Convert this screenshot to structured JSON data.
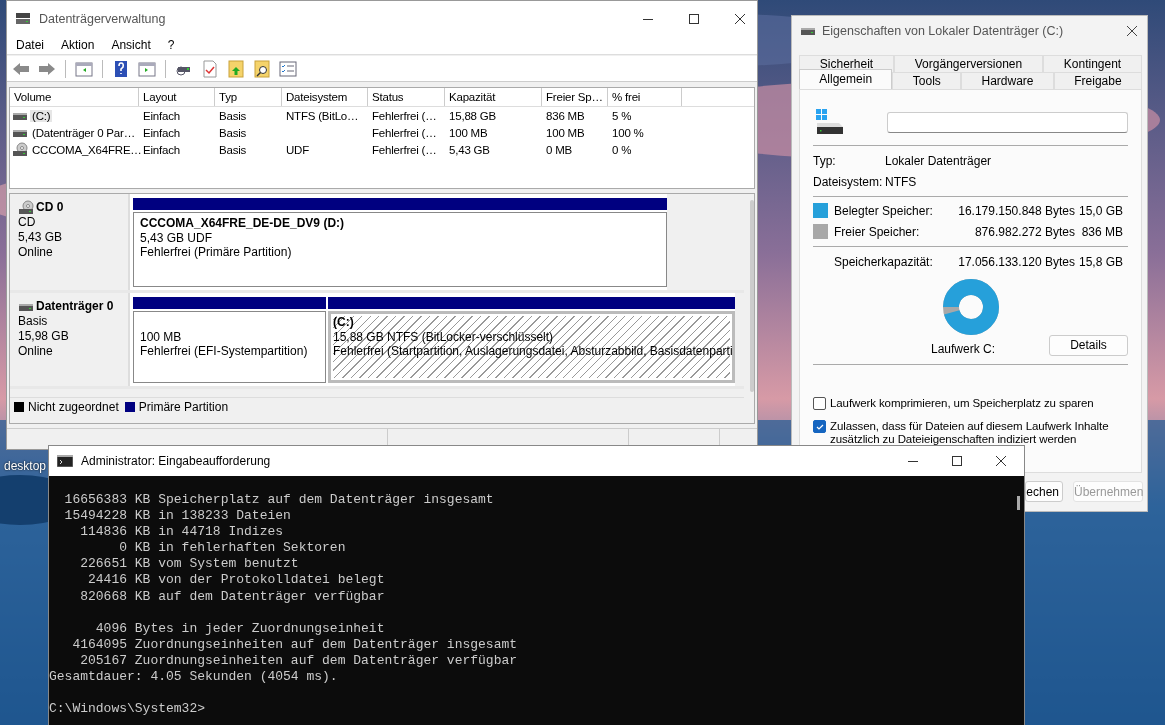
{
  "desktop": {
    "icon_label": "desktop"
  },
  "disk_management": {
    "title": "Datenträgerverwaltung",
    "menu": [
      "Datei",
      "Aktion",
      "Ansicht",
      "?"
    ],
    "volume_table": {
      "columns": [
        "Volume",
        "Layout",
        "Typ",
        "Dateisystem",
        "Status",
        "Kapazität",
        "Freier Sp…",
        "% frei"
      ],
      "rows": [
        {
          "kind": "disk",
          "selected": true,
          "cells": [
            "(C:)",
            "Einfach",
            "Basis",
            "NTFS (BitLo…",
            "Fehlerfrei (…",
            "15,88 GB",
            "836 MB",
            "5 %"
          ]
        },
        {
          "kind": "disk",
          "selected": false,
          "cells": [
            "(Datenträger 0 Par…",
            "Einfach",
            "Basis",
            null,
            "Fehlerfrei (…",
            "100 MB",
            "100 MB",
            "100 %"
          ]
        },
        {
          "kind": "cd",
          "selected": false,
          "cells": [
            "CCCOMA_X64FRE…",
            "Einfach",
            "Basis",
            "UDF",
            "Fehlerfrei (…",
            "5,43 GB",
            "0 MB",
            "0 %"
          ]
        }
      ]
    },
    "disks": [
      {
        "kind": "cd",
        "name": "CD 0",
        "type": "CD",
        "size": "5,43 GB",
        "status": "Online",
        "partitions": [
          {
            "selected": false,
            "title": "CCCOMA_X64FRE_DE-DE_DV9  (D:)",
            "details": [
              "5,43 GB UDF",
              "Fehlerfrei (Primäre Partition)"
            ]
          }
        ]
      },
      {
        "kind": "disk",
        "name": "Datenträger 0",
        "type": "Basis",
        "size": "15,98 GB",
        "status": "Online",
        "partitions": [
          {
            "selected": false,
            "details": [
              "100 MB",
              "Fehlerfrei (EFI-Systempartition)"
            ]
          },
          {
            "selected": true,
            "title": "(C:)",
            "details": [
              "15,88 GB NTFS (BitLocker-verschlüsselt)",
              "Fehlerfrei (Startpartition, Auslagerungsdatei, Absturzabbild, Basisdatenparti"
            ]
          }
        ]
      }
    ],
    "legend": [
      {
        "label": "Nicht zugeordnet",
        "color": "#000000"
      },
      {
        "label": "Primäre Partition",
        "color": "#000080"
      }
    ]
  },
  "properties": {
    "title": "Eigenschaften von Lokaler Datenträger (C:)",
    "tab_rows": [
      [
        {
          "label": "Sicherheit",
          "selected": false
        },
        {
          "label": "Vorgängerversionen",
          "selected": false
        },
        {
          "label": "Kontingent",
          "selected": false
        }
      ],
      [
        {
          "label": "Allgemein",
          "selected": true
        },
        {
          "label": "Tools",
          "selected": false
        },
        {
          "label": "Hardware",
          "selected": false
        },
        {
          "label": "Freigabe",
          "selected": false
        }
      ]
    ],
    "type_label": "Typ:",
    "type_value": "Lokaler Datenträger",
    "fs_label": "Dateisystem:",
    "fs_value": "NTFS",
    "space": [
      {
        "label": "Belegter Speicher:",
        "bytes": "16.179.150.848 Bytes",
        "size": "15,0 GB",
        "color": "#26a0da"
      },
      {
        "label": "Freier Speicher:",
        "bytes": "876.982.272 Bytes",
        "size": "836 MB",
        "color": "#a8a8a8"
      }
    ],
    "capacity": {
      "label": "Speicherkapazität:",
      "bytes": "17.056.133.120 Bytes",
      "size": "15,8 GB"
    },
    "usage_ring": {
      "level": 0.95
    },
    "drive_label": "Laufwerk C:",
    "details_button": "Details",
    "options": [
      {
        "label": "Laufwerk komprimieren, um Speicherplatz zu sparen",
        "checked": false
      },
      {
        "label": "Zulassen, dass für Dateien auf diesem Laufwerk Inhalte zusätzlich zu Dateieigenschaften indiziert werden",
        "checked": true
      }
    ],
    "buttons": [
      {
        "label": "echen",
        "disabled": false
      },
      {
        "label": "Übernehmen",
        "disabled": true
      }
    ]
  },
  "console": {
    "title": "Administrator: Eingabeaufforderung",
    "blocks": [
      [
        "  16656383 KB Speicherplatz auf dem Datenträger insgesamt",
        "  15494228 KB in 138233 Dateien",
        "    114836 KB in 44718 Indizes",
        "         0 KB in fehlerhaften Sektoren",
        "    226651 KB vom System benutzt",
        "     24416 KB von der Protokolldatei belegt",
        "    820668 KB auf dem Datenträger verfügbar"
      ],
      [
        "      4096 Bytes in jeder Zuordnungseinheit",
        "   4164095 Zuordnungseinheiten auf dem Datenträger insgesamt",
        "    205167 Zuordnungseinheiten auf dem Datenträger verfügbar",
        "Gesamtdauer: 4.05 Sekunden (4054 ms)."
      ],
      [
        "C:\\Windows\\System32>"
      ]
    ]
  }
}
